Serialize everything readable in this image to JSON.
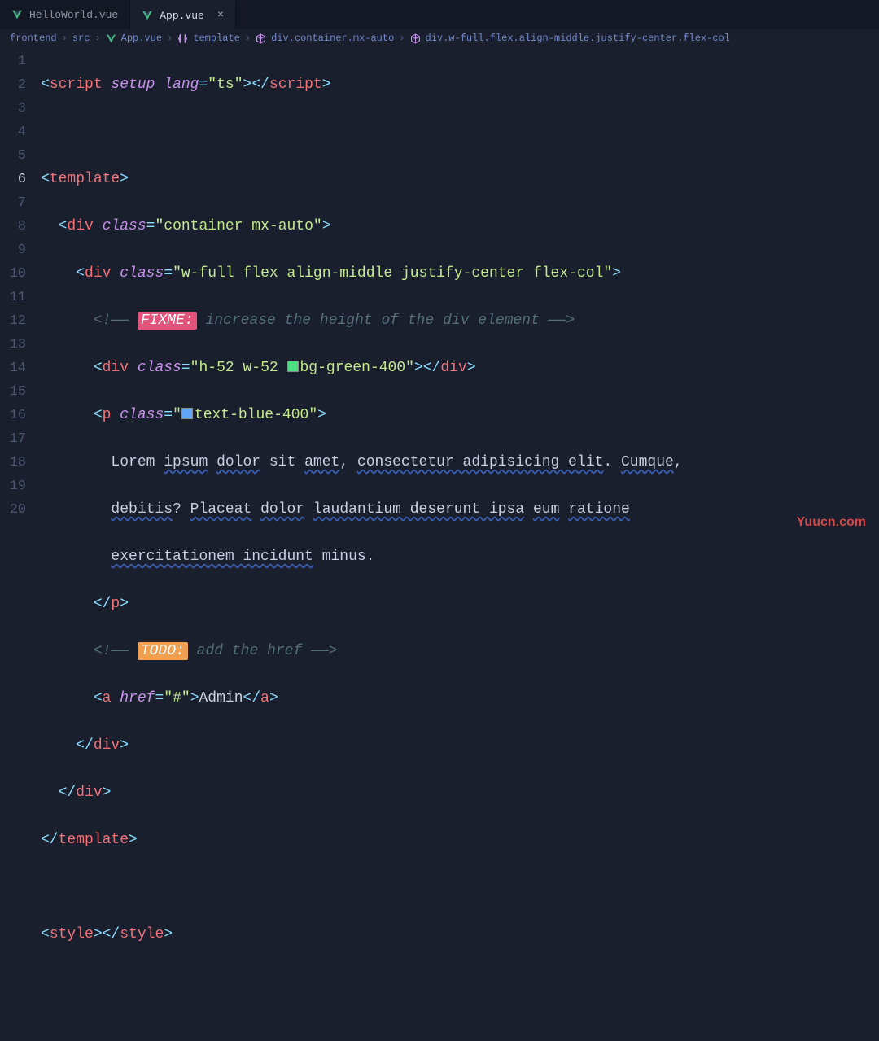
{
  "tabs": {
    "inactive": "HelloWorld.vue",
    "active": "App.vue",
    "close": "×"
  },
  "breadcrumbs": {
    "b1": "frontend",
    "b2": "src",
    "b3": "App.vue",
    "b4": "template",
    "b5": "div.container.mx-auto",
    "b6": "div.w-full.flex.align-middle.justify-center.flex-col",
    "sep": "›"
  },
  "lines": {
    "n1": "1",
    "n2": "2",
    "n3": "3",
    "n4": "4",
    "n5": "5",
    "n6": "6",
    "n7": "7",
    "n8": "8",
    "n9": "9",
    "n10": "10",
    "n11": "11",
    "n12": "12",
    "n13": "13",
    "n14": "14",
    "n15": "15",
    "n16": "16",
    "n17": "17",
    "n18": "18",
    "n19": "19",
    "n20": "20"
  },
  "code": {
    "l1": {
      "t1": "script",
      "a1": "setup",
      "a2": "lang",
      "v1": "\"ts\"",
      "t2": "script"
    },
    "l3": {
      "t1": "template"
    },
    "l4": {
      "t1": "div",
      "a1": "class",
      "v1": "\"container mx-auto\""
    },
    "l5": {
      "t1": "div",
      "a1": "class",
      "v1": "\"w-full flex align-middle justify-center flex-col\""
    },
    "l6": {
      "open": "<!—— ",
      "fixme": "FIXME:",
      "rest": " increase the height of the div element ——>"
    },
    "l7": {
      "t1": "div",
      "a1": "class",
      "v1a": "\"h-52 w-52 ",
      "v1b": "bg-green-400\"",
      "t2": "div"
    },
    "l8": {
      "t1": "p",
      "a1": "class",
      "v1a": "\"",
      "v1b": "text-blue-400\""
    },
    "l9": {
      "txt1": "Lorem ",
      "txt2": "ipsum",
      "txt3": " ",
      "txt4": "dolor",
      "txt5": " sit ",
      "txt6": "amet",
      "txt7": ", ",
      "txt8": "consectetur adipisicing elit",
      "txt9": ". ",
      "txt10": "Cumque",
      "txt11": ","
    },
    "l10": {
      "txt1": "debitis",
      "txt2": "? ",
      "txt3": "Placeat",
      "txt4": " ",
      "txt5": "dolor",
      "txt6": " ",
      "txt7": "laudantium deserunt ipsa",
      "txt8": " ",
      "txt9": "eum",
      "txt10": " ",
      "txt11": "ratione"
    },
    "l11": {
      "txt1": "exercitationem incidunt",
      "txt2": " minus."
    },
    "l12": {
      "t1": "p"
    },
    "l13": {
      "open": "<!—— ",
      "todo": "TODO:",
      "rest": " add the href ——>"
    },
    "l14": {
      "t1": "a",
      "a1": "href",
      "v1": "\"#\"",
      "txt": "Admin",
      "t2": "a"
    },
    "l15": {
      "t1": "div"
    },
    "l16": {
      "t1": "div"
    },
    "l17": {
      "t1": "template"
    },
    "l19": {
      "t1": "style",
      "t2": "style"
    }
  },
  "watermark": "Yuucn.com"
}
